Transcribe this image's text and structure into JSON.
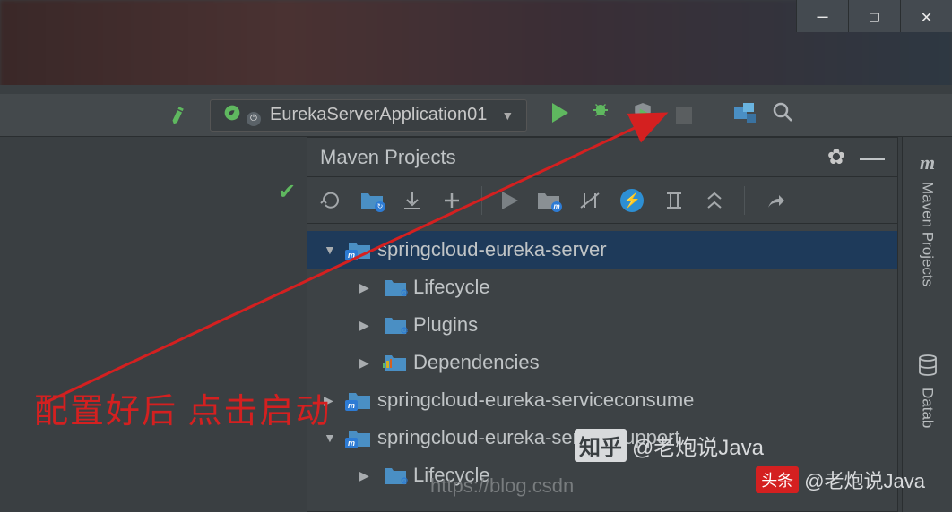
{
  "window": {
    "minimize": "—",
    "maximize": "❐",
    "close": "✕"
  },
  "toolbar": {
    "run_config_label": "EurekaServerApplication01"
  },
  "panel": {
    "title": "Maven Projects"
  },
  "tree": [
    {
      "label": "springcloud-eureka-server",
      "expanded": true,
      "depth": 0,
      "selected": true,
      "icon": "m"
    },
    {
      "label": "Lifecycle",
      "expanded": false,
      "depth": 1,
      "icon": "gear"
    },
    {
      "label": "Plugins",
      "expanded": false,
      "depth": 1,
      "icon": "gear"
    },
    {
      "label": "Dependencies",
      "expanded": false,
      "depth": 1,
      "icon": "bars"
    },
    {
      "label": "springcloud-eureka-serviceconsume",
      "expanded": false,
      "depth": 0,
      "icon": "m"
    },
    {
      "label": "springcloud-eureka-servicesupport",
      "expanded": true,
      "depth": 0,
      "icon": "m"
    },
    {
      "label": "Lifecycle",
      "expanded": false,
      "depth": 1,
      "icon": "gear"
    }
  ],
  "sidebar": {
    "maven_label": "Maven Projects",
    "database_label": "Datab"
  },
  "annotation": {
    "text": "配置好后  点击启动"
  },
  "watermarks": {
    "csdn": "https://blog.csdn",
    "zhihu": "知乎",
    "toutiao_prefix": "头条",
    "toutiao_user": "@老炮说Java"
  }
}
